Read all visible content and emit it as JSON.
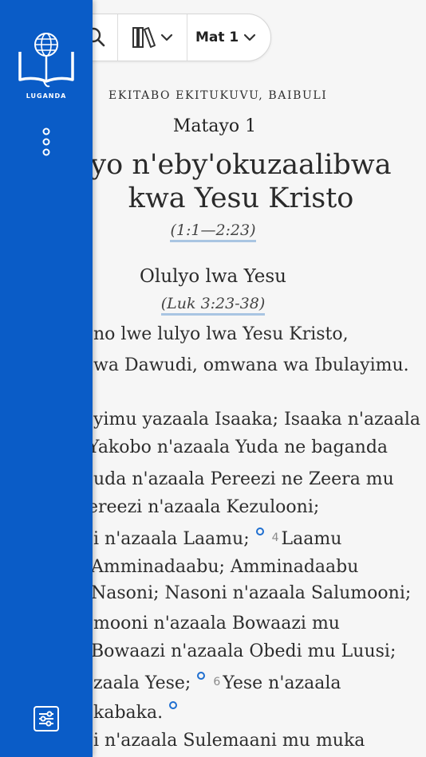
{
  "toolbar": {
    "icons": [
      "search-icon",
      "library-icon",
      "chevron-down-icon"
    ],
    "chapter_selector": "Mat 1"
  },
  "sidebar": {
    "language_label": "LUGANDA",
    "icons": [
      "bible-globe-logo-icon",
      "more-vertical-icon",
      "settings-sliders-icon"
    ],
    "accent_color": "#0a5cc7"
  },
  "content": {
    "book_label": "EKITABO EKITUKUVU, BAIBULI",
    "chapter_label": "Matayo 1",
    "title_line1": "yo n'eby'okuzaalibwa",
    "title_line2": "kwa Yesu Kristo",
    "title_reference": "(1:1—2:23)",
    "subheading": "Olulyo lwa Yesu",
    "subheading_reference": "(Luk 3:23-38)",
    "link_color": "#1f6fd0"
  },
  "verses": [
    {
      "text": "no lwe lulyo lwa Yesu Kristo,"
    },
    {
      "text": "wa Dawudi, omwana wa Ibulayimu."
    },
    {
      "text": "yimu yazaala Isaaka; Isaaka n'azaala"
    },
    {
      "text": "Yakobo n'azaala Yuda ne baganda"
    },
    {
      "text": "uda n'azaala Pereezi ne Zeera mu"
    },
    {
      "text": "ereezi n'azaala Kezulooni;"
    },
    {
      "text": "i n'azaala Laamu;",
      "note": true,
      "num": "4",
      "after": "Laamu"
    },
    {
      "text": "Amminadaabu; Amminadaabu"
    },
    {
      "text": "Nasoni; Nasoni n'azaala Salumooni;"
    },
    {
      "text": "mooni n'azaala Bowaazi mu"
    },
    {
      "text": "Bowaazi n'azaala Obedi mu Luusi;"
    },
    {
      "text": "zaala Yese;",
      "note": true,
      "num": "6",
      "after": "Yese n'azaala"
    },
    {
      "text": "kabaka.",
      "note": true
    },
    {
      "text": "i n'azaala Sulemaani mu muka"
    }
  ]
}
